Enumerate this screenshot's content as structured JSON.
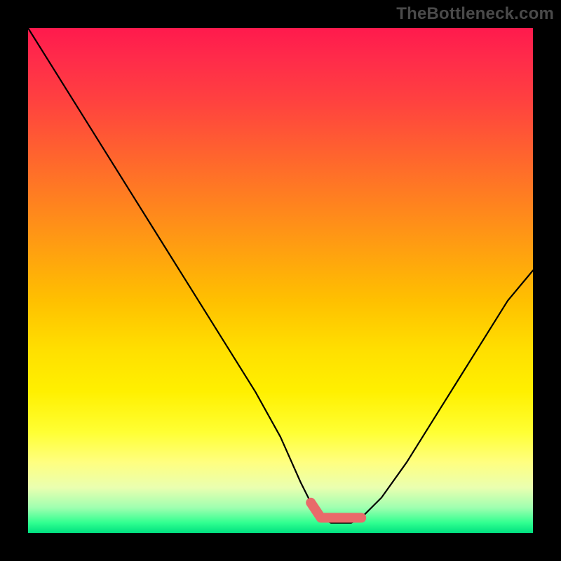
{
  "watermark": "TheBottleneck.com",
  "chart_data": {
    "type": "line",
    "title": "",
    "xlabel": "",
    "ylabel": "",
    "xlim": [
      0,
      100
    ],
    "ylim": [
      0,
      100
    ],
    "grid": false,
    "legend": false,
    "series": [
      {
        "name": "bottleneck-curve",
        "x": [
          0,
          5,
          10,
          15,
          20,
          25,
          30,
          35,
          40,
          45,
          50,
          54,
          56,
          58,
          60,
          62,
          64,
          66,
          70,
          75,
          80,
          85,
          90,
          95,
          100
        ],
        "y": [
          100,
          92,
          84,
          76,
          68,
          60,
          52,
          44,
          36,
          28,
          19,
          10,
          6,
          3,
          2,
          2,
          2,
          3,
          7,
          14,
          22,
          30,
          38,
          46,
          52
        ]
      }
    ],
    "annotations": [
      {
        "name": "minimum-zone",
        "x_range": [
          56,
          66
        ],
        "y": 3,
        "style": "thick-pink-stroke"
      }
    ],
    "background_gradient_stops": [
      {
        "pos": 0,
        "color": "#ff1a4d"
      },
      {
        "pos": 24,
        "color": "#ff6030"
      },
      {
        "pos": 54,
        "color": "#ffc000"
      },
      {
        "pos": 80,
        "color": "#ffff80"
      },
      {
        "pos": 100,
        "color": "#00e080"
      }
    ]
  }
}
